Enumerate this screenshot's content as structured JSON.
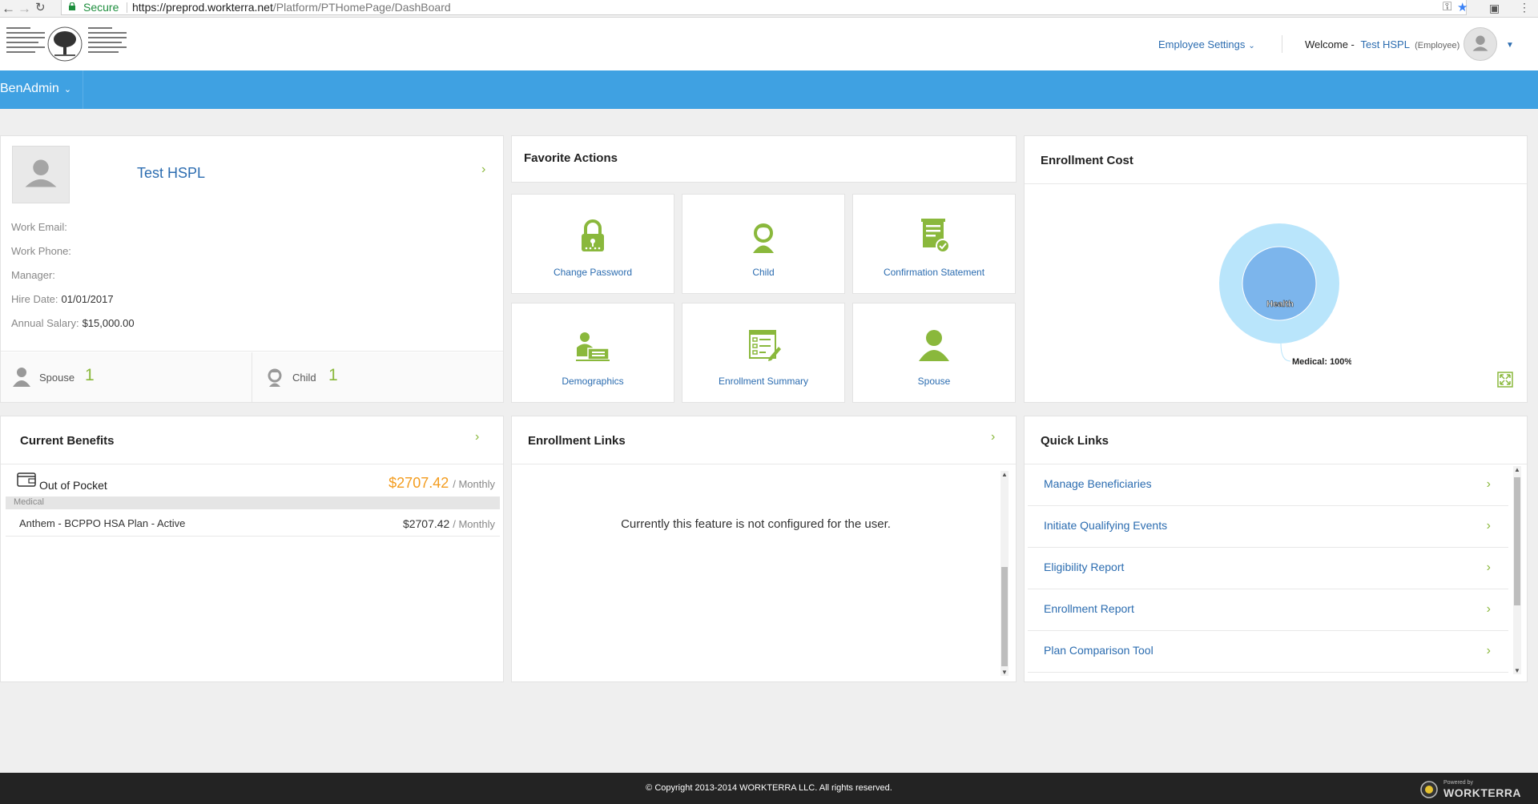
{
  "browser": {
    "secure_label": "Secure",
    "url_host": "https://preprod.workterra.net",
    "url_path": "/Platform/PTHomePage/DashBoard"
  },
  "header": {
    "employee_settings": "Employee Settings",
    "welcome_label": "Welcome -",
    "user_name": "Test HSPL",
    "user_role": "(Employee)"
  },
  "nav": {
    "module": "BenAdmin"
  },
  "profile": {
    "name": "Test HSPL",
    "fields": [
      {
        "label": "Work Email:",
        "value": ""
      },
      {
        "label": "Work Phone:",
        "value": ""
      },
      {
        "label": "Manager:",
        "value": ""
      },
      {
        "label": "Hire Date:",
        "value": "01/01/2017"
      },
      {
        "label": "Annual Salary:",
        "value": "$15,000.00"
      }
    ],
    "dependents": [
      {
        "label": "Spouse",
        "count": "1"
      },
      {
        "label": "Child",
        "count": "1"
      }
    ]
  },
  "favorite_actions": {
    "title": "Favorite Actions",
    "tiles": [
      {
        "label": "Change Password",
        "icon": "lock-icon"
      },
      {
        "label": "Child",
        "icon": "child-icon"
      },
      {
        "label": "Confirmation Statement",
        "icon": "document-check-icon"
      },
      {
        "label": "Demographics",
        "icon": "id-card-icon"
      },
      {
        "label": "Enrollment Summary",
        "icon": "form-edit-icon"
      },
      {
        "label": "Spouse",
        "icon": "person-icon"
      }
    ]
  },
  "enrollment_cost": {
    "title": "Enrollment Cost",
    "chart_data": {
      "type": "pie",
      "title": "",
      "inner_categories": [
        "Health"
      ],
      "outer_categories": [
        "Medical"
      ],
      "values": [
        100
      ],
      "data_labels": [
        "Medical: 100%"
      ],
      "colors": {
        "inner": "#7cb5ec",
        "outer": "#b9e5fb"
      }
    }
  },
  "current_benefits": {
    "title": "Current Benefits",
    "oop_label": "Out of Pocket",
    "oop_amount": "$2707.42",
    "per": "/ Monthly",
    "category": "Medical",
    "plans": [
      {
        "name": "Anthem - BCPPO HSA Plan - Active",
        "amount": "$2707.42",
        "per": "/ Monthly"
      }
    ]
  },
  "enrollment_links": {
    "title": "Enrollment Links",
    "message": "Currently this feature is not configured for the user."
  },
  "quick_links": {
    "title": "Quick Links",
    "items": [
      "Manage Beneficiaries",
      "Initiate Qualifying Events",
      "Eligibility Report",
      "Enrollment Report",
      "Plan Comparison Tool"
    ]
  },
  "footer": {
    "copyright": "© Copyright 2013-2014 WORKTERRA LLC. All rights reserved.",
    "powered_by": "Powered by",
    "brand": "WORKTERRA"
  },
  "colors": {
    "accent": "#3fa1e2",
    "green": "#8ab83c",
    "link": "#2b6cb0",
    "amount": "#f39c1e"
  }
}
